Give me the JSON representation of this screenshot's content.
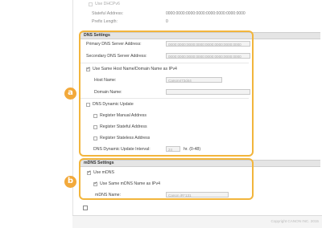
{
  "top": {
    "use_dhcpv6_label": "Use DHCPv6",
    "stateful_address_label": "Stateful Address:",
    "stateful_address_value": "0000:0000:0000:0000:0000:0000:0000:0000",
    "prefix_length_label": "Prefix Length:",
    "prefix_length_value": "0"
  },
  "dns": {
    "header": "DNS Settings",
    "primary_label": "Primary DNS Server Address:",
    "primary_value": "0000:0000:0000:0000:0000:0000:0000:0000",
    "secondary_label": "Secondary DNS Server Address:",
    "secondary_value": "0000:0000:0000:0000:0000:0000:0000:0000",
    "use_same_label": "Use Same Host Name/Domain Name as IPv4",
    "host_name_label": "Host Name:",
    "host_name_value": "Canon473d44",
    "domain_name_label": "Domain Name:",
    "domain_name_value": "",
    "dynamic_update_label": "DNS Dynamic Update",
    "register_manual_label": "Register Manual Address",
    "register_stateful_label": "Register Stateful Address",
    "register_stateless_label": "Register Stateless Address",
    "interval_label": "DNS Dynamic Update Interval:",
    "interval_value": "24",
    "interval_unit": "hr. (0-48)"
  },
  "mdns": {
    "header": "mDNS Settings",
    "use_mdns_label": "Use mDNS",
    "use_same_label": "Use Same mDNS Name as IPv4",
    "mdns_name_label": "mDNS Name:",
    "mdns_name_value": "Canon iR*131"
  },
  "callouts": {
    "a": "a",
    "b": "b"
  },
  "footer": {
    "copyright": "Copyright CANON INC. 2015"
  },
  "colors": {
    "accent": "#f2a93b",
    "frame": "#f2b53c"
  }
}
